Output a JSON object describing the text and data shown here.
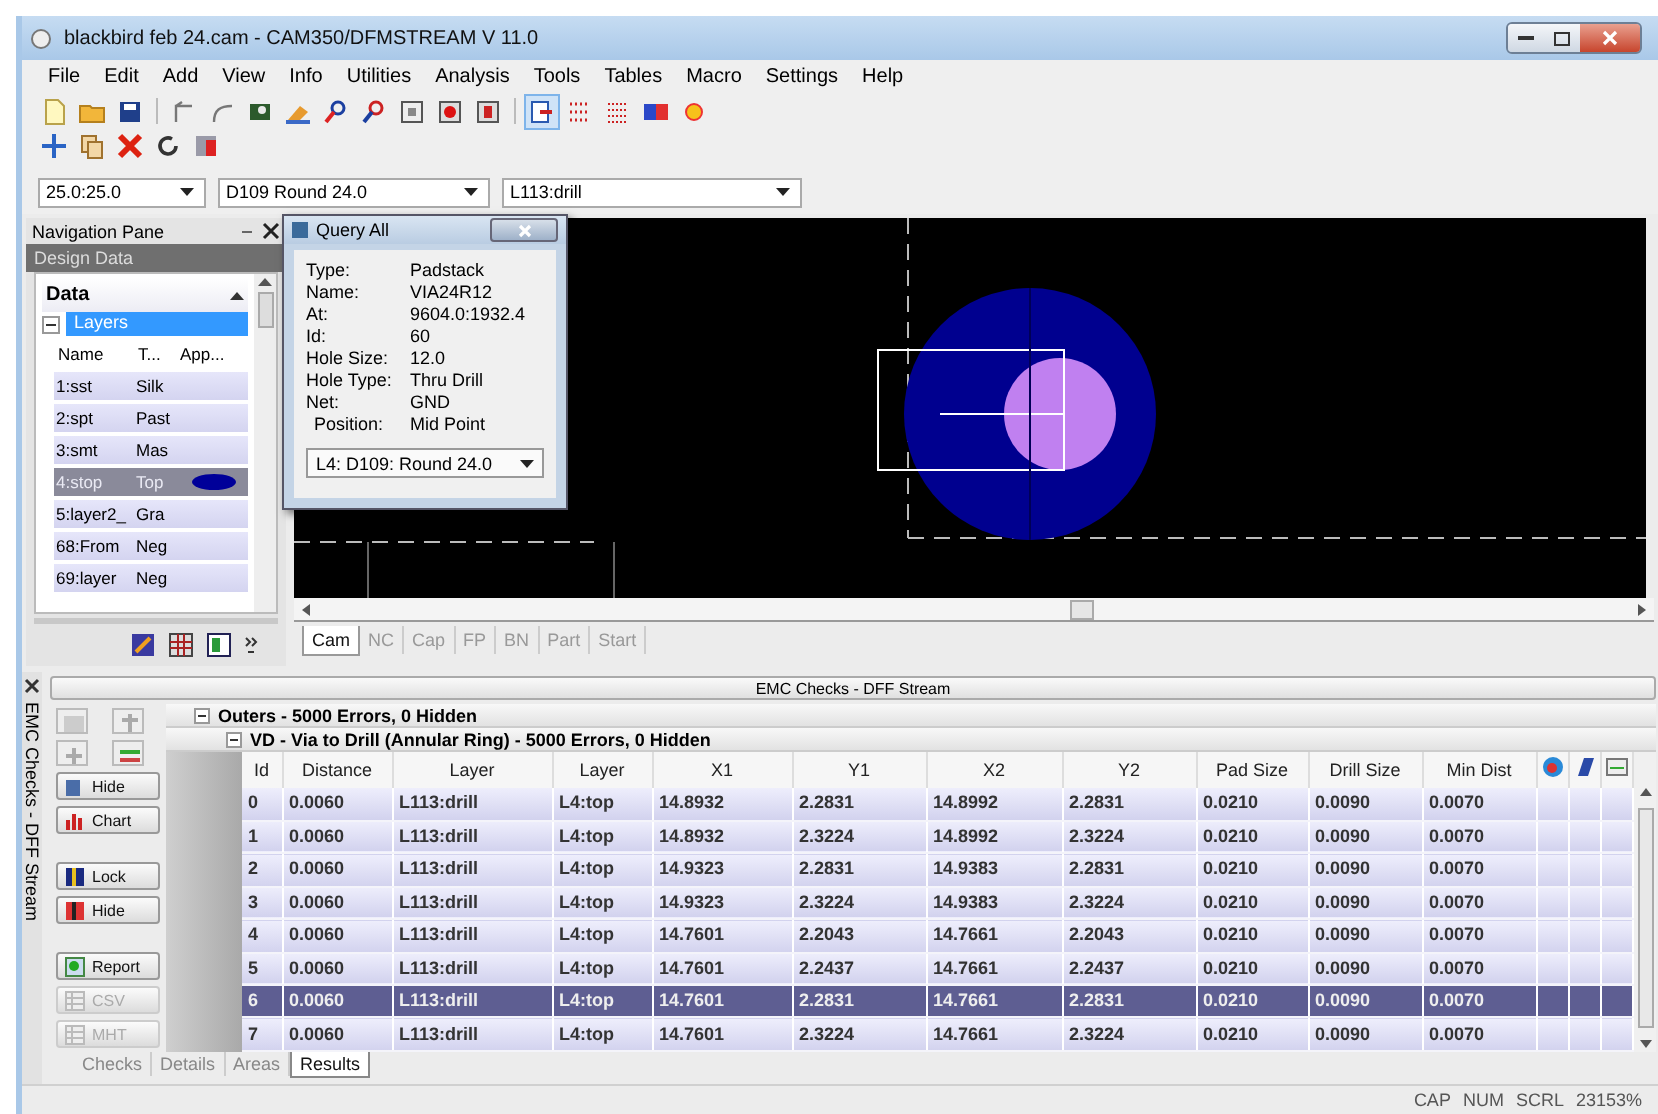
{
  "window": {
    "title": "blackbird feb 24.cam - CAM350/DFMSTREAM V 11.0"
  },
  "menu": [
    "File",
    "Edit",
    "Add",
    "View",
    "Info",
    "Utilities",
    "Analysis",
    "Tools",
    "Tables",
    "Macro",
    "Settings",
    "Help"
  ],
  "selectors": [
    "25.0:25.0",
    "D109 Round 24.0",
    "L113:drill"
  ],
  "navigation_pane": {
    "title": "Navigation Pane",
    "header": "Design Data",
    "section": "Data",
    "group": "Layers",
    "columns": [
      "Name",
      "T...",
      "App..."
    ],
    "rows": [
      {
        "name": "1:sst",
        "type": "Silk",
        "selected": false
      },
      {
        "name": "2:spt",
        "type": "Past",
        "selected": false
      },
      {
        "name": "3:smt",
        "type": "Mas",
        "selected": false
      },
      {
        "name": "4:stop",
        "type": "Top",
        "selected": true,
        "color": "#000099"
      },
      {
        "name": "5:layer2_",
        "type": "Gra",
        "selected": false
      },
      {
        "name": "68:From",
        "type": "Neg",
        "selected": false
      },
      {
        "name": "69:layer",
        "type": "Neg",
        "selected": false
      }
    ]
  },
  "query_dialog": {
    "title": "Query All",
    "fields": [
      {
        "label": "Type:",
        "value": "Padstack"
      },
      {
        "label": "Name:",
        "value": "VIA24R12"
      },
      {
        "label": "At:",
        "value": "9604.0:1932.4"
      },
      {
        "label": "Id:",
        "value": "60"
      },
      {
        "label": "Hole Size:",
        "value": "12.0"
      },
      {
        "label": "Hole Type:",
        "value": "Thru Drill"
      },
      {
        "label": "Net:",
        "value": "GND"
      },
      {
        "label": "Position:",
        "value": "Mid Point"
      }
    ],
    "selector": "L4: D109: Round 24.0"
  },
  "view_tabs": [
    {
      "label": "Cam",
      "selected": true
    },
    {
      "label": "NC",
      "selected": false
    },
    {
      "label": "Cap",
      "selected": false
    },
    {
      "label": "FP",
      "selected": false
    },
    {
      "label": "BN",
      "selected": false
    },
    {
      "label": "Part",
      "selected": false
    },
    {
      "label": "Start",
      "selected": false
    }
  ],
  "emc_panel": {
    "title": "EMC Checks - DFF Stream",
    "side_label": "EMC Checks - DFF Stream",
    "buttons": [
      {
        "label": "Hide",
        "disabled": false
      },
      {
        "label": "Chart",
        "disabled": false
      },
      {
        "label": "Lock",
        "disabled": false
      },
      {
        "label": "Hide",
        "disabled": false
      },
      {
        "label": "Report",
        "disabled": false
      },
      {
        "label": "CSV",
        "disabled": true
      },
      {
        "label": "MHT",
        "disabled": true
      }
    ],
    "groups": [
      "Outers - 5000 Errors, 0 Hidden",
      "VD - Via to Drill (Annular Ring) - 5000 Errors, 0 Hidden"
    ],
    "columns": [
      "Id",
      "Distance",
      "Layer",
      "Layer",
      "X1",
      "Y1",
      "X2",
      "Y2",
      "Pad Size",
      "Drill Size",
      "Min Dist"
    ],
    "rows": [
      {
        "cells": [
          "0",
          "0.0060",
          "L113:drill",
          "L4:top",
          "14.8932",
          "2.2831",
          "14.8992",
          "2.2831",
          "0.0210",
          "0.0090",
          "0.0070"
        ],
        "selected": false
      },
      {
        "cells": [
          "1",
          "0.0060",
          "L113:drill",
          "L4:top",
          "14.8932",
          "2.3224",
          "14.8992",
          "2.3224",
          "0.0210",
          "0.0090",
          "0.0070"
        ],
        "selected": false
      },
      {
        "cells": [
          "2",
          "0.0060",
          "L113:drill",
          "L4:top",
          "14.9323",
          "2.2831",
          "14.9383",
          "2.2831",
          "0.0210",
          "0.0090",
          "0.0070"
        ],
        "selected": false
      },
      {
        "cells": [
          "3",
          "0.0060",
          "L113:drill",
          "L4:top",
          "14.9323",
          "2.3224",
          "14.9383",
          "2.3224",
          "0.0210",
          "0.0090",
          "0.0070"
        ],
        "selected": false
      },
      {
        "cells": [
          "4",
          "0.0060",
          "L113:drill",
          "L4:top",
          "14.7601",
          "2.2043",
          "14.7661",
          "2.2043",
          "0.0210",
          "0.0090",
          "0.0070"
        ],
        "selected": false
      },
      {
        "cells": [
          "5",
          "0.0060",
          "L113:drill",
          "L4:top",
          "14.7601",
          "2.2437",
          "14.7661",
          "2.2437",
          "0.0210",
          "0.0090",
          "0.0070"
        ],
        "selected": false
      },
      {
        "cells": [
          "6",
          "0.0060",
          "L113:drill",
          "L4:top",
          "14.7601",
          "2.2831",
          "14.7661",
          "2.2831",
          "0.0210",
          "0.0090",
          "0.0070"
        ],
        "selected": true
      },
      {
        "cells": [
          "7",
          "0.0060",
          "L113:drill",
          "L4:top",
          "14.7601",
          "2.3224",
          "14.7661",
          "2.3224",
          "0.0210",
          "0.0090",
          "0.0070"
        ],
        "selected": false
      }
    ],
    "tabs": [
      {
        "label": "Checks",
        "selected": false
      },
      {
        "label": "Details",
        "selected": false
      },
      {
        "label": "Areas",
        "selected": false
      },
      {
        "label": "Results",
        "selected": true
      }
    ]
  },
  "status_bar": [
    "CAP",
    "NUM",
    "SCRL",
    "23153%"
  ]
}
